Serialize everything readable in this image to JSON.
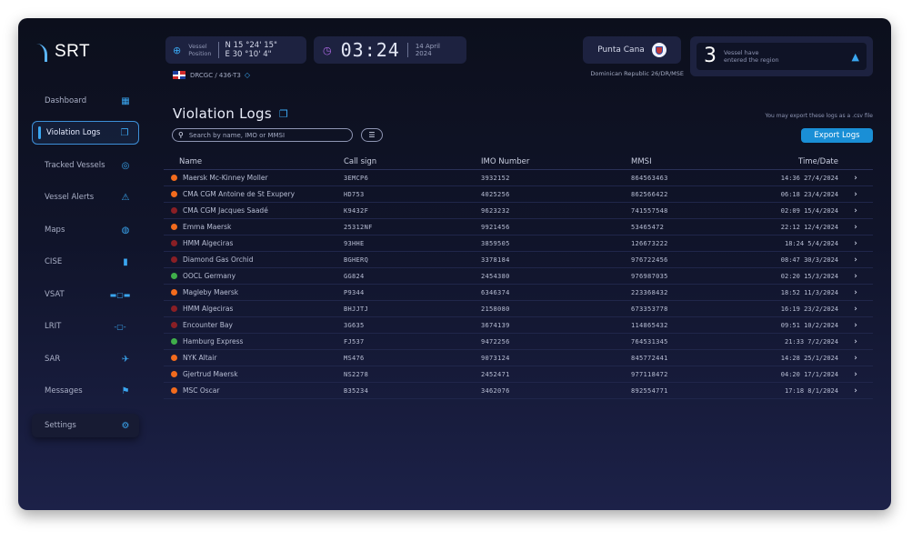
{
  "app": {
    "logo_text": "SRT"
  },
  "sidebar": {
    "items": [
      {
        "label": "Dashboard",
        "icon": "▦"
      },
      {
        "label": "Violation Logs",
        "icon": "❐"
      },
      {
        "label": "Tracked Vessels",
        "icon": "◎"
      },
      {
        "label": "Vessel Alerts",
        "icon": "⚠"
      },
      {
        "label": "Maps",
        "icon": "◍"
      },
      {
        "label": "CISE",
        "icon": "▮"
      },
      {
        "label": "VSAT",
        "icon": "▬▢▬"
      },
      {
        "label": "LRIT",
        "icon": "-▢-"
      },
      {
        "label": "SAR",
        "icon": "✈"
      },
      {
        "label": "Messages",
        "icon": "⚑"
      }
    ],
    "settings": {
      "label": "Settings",
      "icon": "⚙"
    }
  },
  "header": {
    "position_label_1": "Vessel",
    "position_label_2": "Position",
    "lat": "N 15 °24' 15\"",
    "lon": "E 30 °10' 4\"",
    "time": "03:24",
    "date_1": "14 April",
    "date_2": "2024",
    "vessel_code": "DRCGC / 436-T3",
    "place": "Punta Cana",
    "place_sub": "Dominican Republic 26/DR/MSE",
    "alert_count": "3",
    "alert_text_1": "Vessel have",
    "alert_text_2": "entered the region"
  },
  "main": {
    "title": "Violation Logs",
    "search_placeholder": "Search by name, IMO or MMSI",
    "export_note": "You may export these logs as a .csv file",
    "export_label": "Export Logs"
  },
  "colors": {
    "orange": "#f26b1d",
    "red": "#8a1f25",
    "green": "#3fae4a",
    "accent": "#1a8fd6"
  },
  "table": {
    "headers": [
      "Name",
      "Call sign",
      "IMO Number",
      "MMSI",
      "Time/Date"
    ],
    "rows": [
      {
        "status": "orange",
        "name": "Maersk Mc-Kinney Moller",
        "call": "3EMCP6",
        "imo": "3932152",
        "mmsi": "864563463",
        "time": "14:36  27/4/2024"
      },
      {
        "status": "orange",
        "name": "CMA CGM Antoine de St Exupery",
        "call": "HD753",
        "imo": "4025256",
        "mmsi": "862566422",
        "time": "06:18  23/4/2024"
      },
      {
        "status": "red",
        "name": "CMA CGM Jacques Saadé",
        "call": "K9432F",
        "imo": "9623232",
        "mmsi": "741557548",
        "time": "02:09  15/4/2024"
      },
      {
        "status": "orange",
        "name": "Emma Maersk",
        "call": "25312NF",
        "imo": "9921456",
        "mmsi": "53465472",
        "time": "22:12  12/4/2024"
      },
      {
        "status": "red",
        "name": "HMM Algeciras",
        "call": "93HHE",
        "imo": "3859505",
        "mmsi": "126673222",
        "time": "18:24  5/4/2024"
      },
      {
        "status": "red",
        "name": "Diamond Gas Orchid",
        "call": "BGHERQ",
        "imo": "3378184",
        "mmsi": "976722456",
        "time": "08:47  30/3/2024"
      },
      {
        "status": "green",
        "name": "OOCL Germany",
        "call": "GG824",
        "imo": "2454380",
        "mmsi": "976987035",
        "time": "02:20  15/3/2024"
      },
      {
        "status": "orange",
        "name": "Magleby Maersk",
        "call": "P9344",
        "imo": "6346374",
        "mmsi": "223368432",
        "time": "18:52  11/3/2024"
      },
      {
        "status": "red",
        "name": "HMM Algeciras",
        "call": "BHJJTJ",
        "imo": "2158080",
        "mmsi": "673353778",
        "time": "16:19  23/2/2024"
      },
      {
        "status": "red",
        "name": "Encounter Bay",
        "call": "3G635",
        "imo": "3674139",
        "mmsi": "114865432",
        "time": "09:51  10/2/2024"
      },
      {
        "status": "green",
        "name": "Hamburg Express",
        "call": "FJ537",
        "imo": "9472256",
        "mmsi": "764531345",
        "time": "21:33  7/2/2024"
      },
      {
        "status": "orange",
        "name": "NYK Altair",
        "call": "MS476",
        "imo": "9073124",
        "mmsi": "845772441",
        "time": "14:28  25/1/2024"
      },
      {
        "status": "orange",
        "name": "Gjertrud Maersk",
        "call": "NS2278",
        "imo": "2452471",
        "mmsi": "977118472",
        "time": "04:20  17/1/2024"
      },
      {
        "status": "orange",
        "name": "MSC Oscar",
        "call": "B35234",
        "imo": "3462076",
        "mmsi": "892554771",
        "time": "17:18  8/1/2024"
      }
    ]
  }
}
